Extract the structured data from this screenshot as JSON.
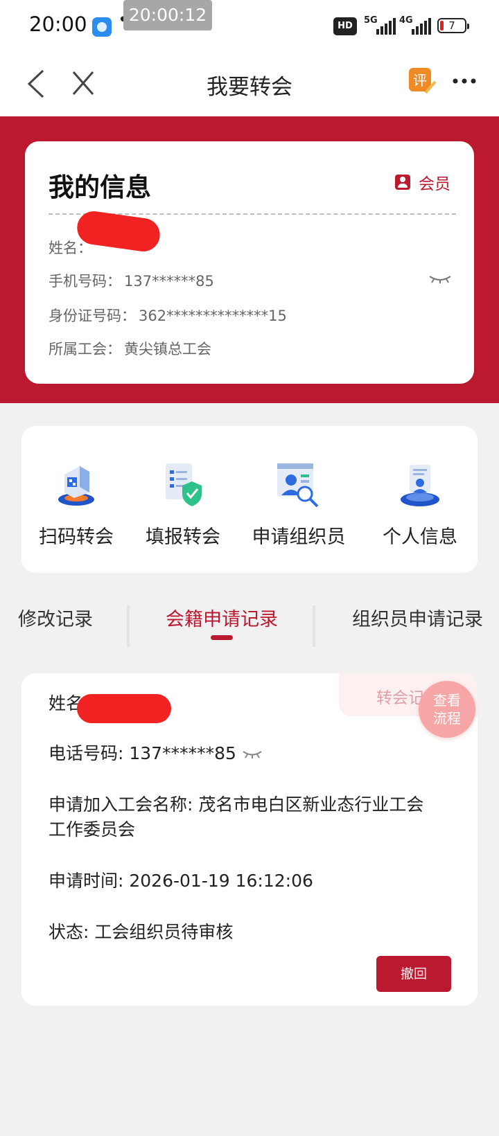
{
  "status_bar": {
    "time": "20:00",
    "more_dots": "•••",
    "clock_overlay": "20:00:12",
    "hd_badge": "HD",
    "network_1": "5G",
    "network_2": "4G",
    "battery_level": "7"
  },
  "nav": {
    "title": "我要转会",
    "rate_icon_text": "评"
  },
  "info_card": {
    "title": "我的信息",
    "badge": "会员",
    "name_label": "姓名：",
    "phone_label": "手机号码：",
    "phone_value": "137******85",
    "id_label": "身份证号码：",
    "id_value": "362**************15",
    "union_label": "所属工会：",
    "union_value": "黄尖镇总工会"
  },
  "actions": [
    {
      "label": "扫码转会",
      "icon": "qr-transfer-icon"
    },
    {
      "label": "填报转会",
      "icon": "form-shield-icon"
    },
    {
      "label": "申请组织员",
      "icon": "organizer-search-icon"
    },
    {
      "label": "个人信息",
      "icon": "personal-info-icon"
    }
  ],
  "tabs": [
    {
      "label": "修改记录",
      "active": false
    },
    {
      "label": "会籍申请记录",
      "active": true
    },
    {
      "label": "组织员申请记录",
      "active": false
    }
  ],
  "record": {
    "tag": "转会记",
    "name_label": "姓名",
    "phone": "电话号码: 137******85",
    "union_line1": "申请加入工会名称: 茂名市电白区新业态行业工会",
    "union_line2": "工作委员会",
    "time": "申请时间: 2026-01-19 16:12:06",
    "status": "状态: 工会组织员待审核",
    "revoke": "撤回"
  },
  "flow_button": {
    "line1": "查看",
    "line2": "流程"
  },
  "colors": {
    "brand_red": "#bb1930",
    "background": "#f1f1f1",
    "redaction": "#f02222"
  }
}
